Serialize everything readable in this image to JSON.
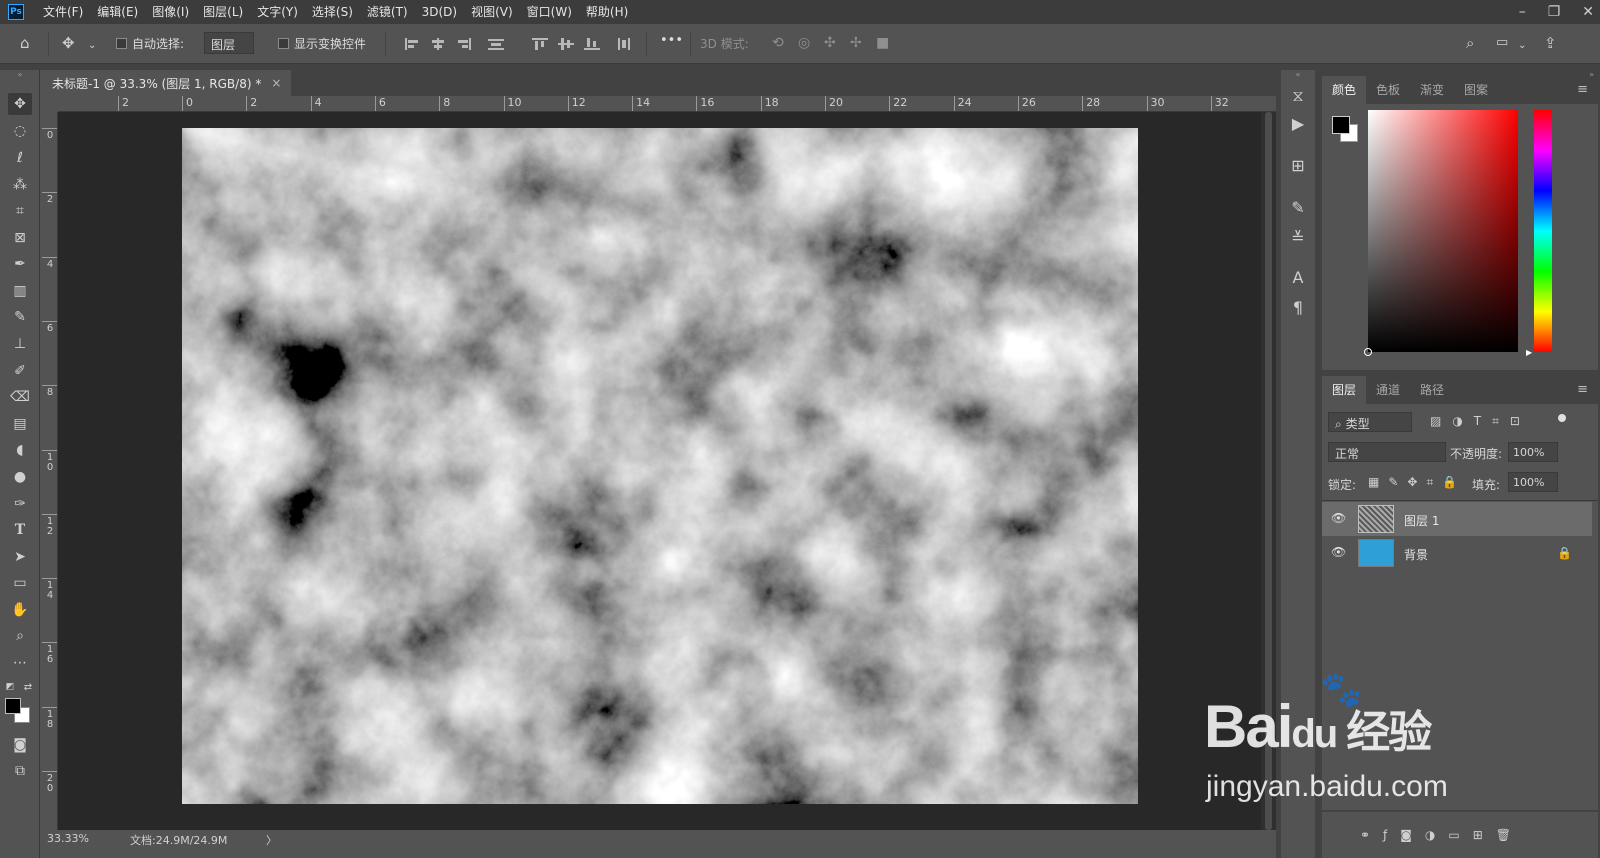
{
  "app": {
    "logo": "Ps"
  },
  "menu": [
    "文件(F)",
    "编辑(E)",
    "图像(I)",
    "图层(L)",
    "文字(Y)",
    "选择(S)",
    "滤镜(T)",
    "3D(D)",
    "视图(V)",
    "窗口(W)",
    "帮助(H)"
  ],
  "window_controls": {
    "minimize": "–",
    "restore": "❐",
    "close": "✕"
  },
  "options": {
    "auto_select_label": "自动选择:",
    "auto_select_value": "图层",
    "show_transform_label": "显示变换控件",
    "three_d_mode_label": "3D 模式:",
    "more": "•••"
  },
  "document": {
    "tab_title": "未标题-1 @ 33.3% (图层 1, RGB/8) *",
    "tab_close": "×",
    "zoom": "33.33%",
    "doc_size": "文档:24.9M/24.9M",
    "status_arrow": "〉"
  },
  "rulers": {
    "h_ticks": [
      "2",
      "0",
      "2",
      "4",
      "6",
      "8",
      "10",
      "12",
      "14",
      "16",
      "18",
      "20",
      "22",
      "24",
      "26",
      "28",
      "30",
      "32"
    ],
    "v_ticks": [
      "0",
      "2",
      "4",
      "6",
      "8",
      "10",
      "12",
      "14",
      "16",
      "18",
      "20"
    ]
  },
  "color_panel": {
    "tabs": [
      "颜色",
      "色板",
      "渐变",
      "图案"
    ],
    "active_tab": 0,
    "foreground_color": "#000000",
    "background_color": "#ffffff",
    "hue_color": "#ff0000"
  },
  "layers_panel": {
    "tabs": [
      "图层",
      "通道",
      "路径"
    ],
    "active_tab": 0,
    "filter_label": "类型",
    "blend_mode": "正常",
    "opacity_label": "不透明度:",
    "opacity_value": "100%",
    "lock_label": "锁定:",
    "fill_label": "填充:",
    "fill_value": "100%",
    "layers": [
      {
        "name": "图层 1",
        "selected": true,
        "locked": false,
        "thumb_color": "#8a8a8a"
      },
      {
        "name": "背景",
        "selected": false,
        "locked": true,
        "thumb_color": "#2f9fd8"
      }
    ]
  },
  "watermark": {
    "brand_a": "Bai",
    "brand_b": "du",
    "brand_c": "经验",
    "url": "jingyan.baidu.com"
  }
}
